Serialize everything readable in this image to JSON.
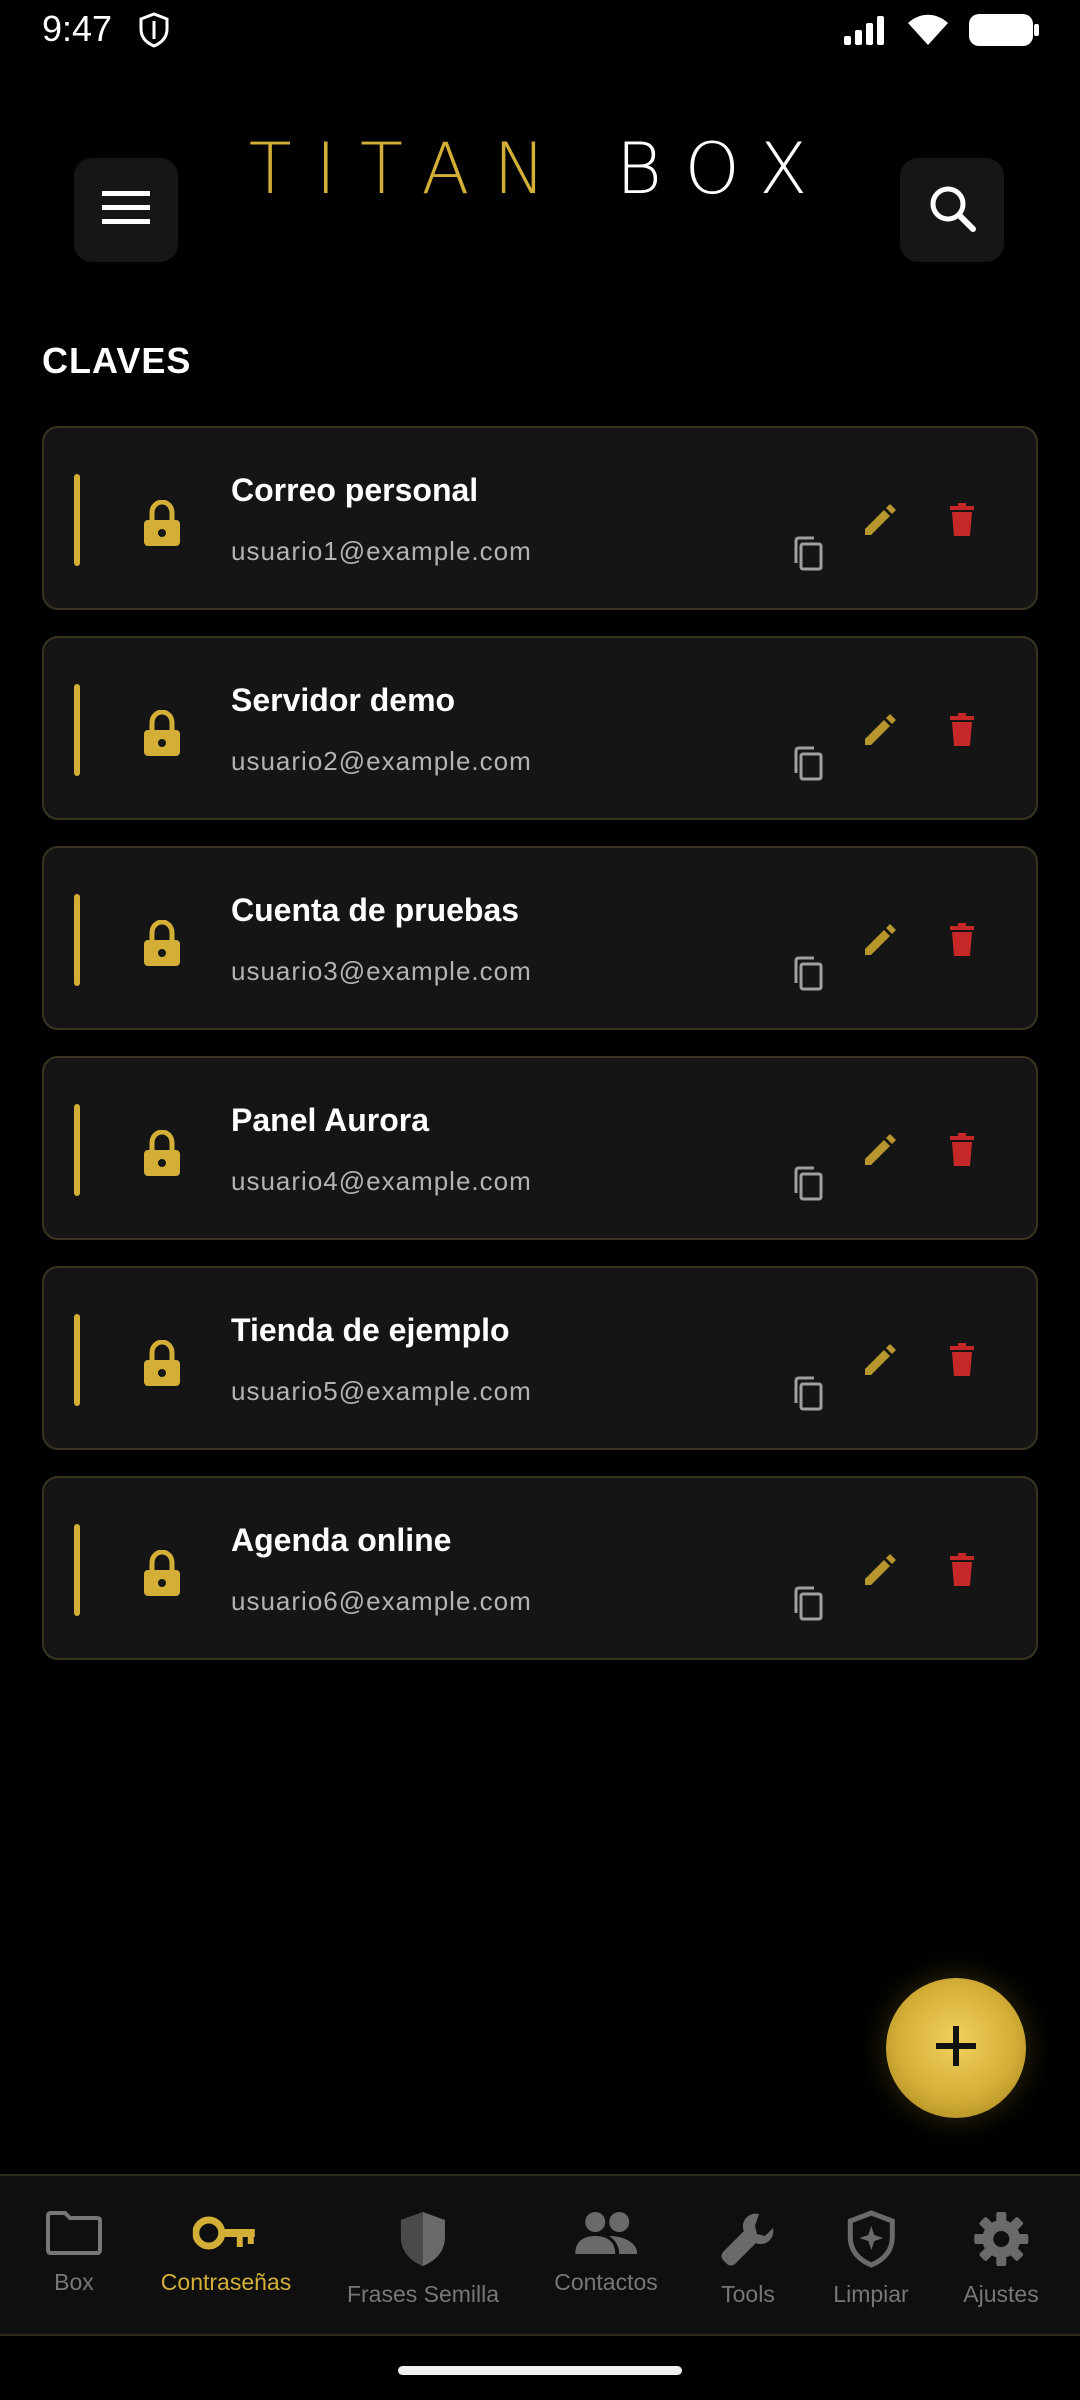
{
  "status": {
    "time": "9:47"
  },
  "header": {
    "logo_part1": "TITAN",
    "logo_part2": "BOX"
  },
  "section_title": "CLAVES",
  "entries": [
    {
      "title": "Correo personal",
      "email": "usuario1@example.com"
    },
    {
      "title": "Servidor demo",
      "email": "usuario2@example.com"
    },
    {
      "title": "Cuenta de pruebas",
      "email": "usuario3@example.com"
    },
    {
      "title": "Panel Aurora",
      "email": "usuario4@example.com"
    },
    {
      "title": "Tienda de ejemplo",
      "email": "usuario5@example.com"
    },
    {
      "title": "Agenda online",
      "email": "usuario6@example.com"
    }
  ],
  "fab_icon": "plus-icon",
  "nav": [
    {
      "label": "Box",
      "icon": "folder-icon",
      "active": false
    },
    {
      "label": "Contraseñas",
      "icon": "key-icon",
      "active": true
    },
    {
      "label": "Frases Semilla",
      "icon": "shield-icon",
      "active": false
    },
    {
      "label": "Contactos",
      "icon": "people-icon",
      "active": false
    },
    {
      "label": "Tools",
      "icon": "wrench-icon",
      "active": false
    },
    {
      "label": "Limpiar",
      "icon": "shield-sparkle-icon",
      "active": false
    },
    {
      "label": "Ajustes",
      "icon": "gear-icon",
      "active": false
    }
  ],
  "colors": {
    "accent": "#d4af37",
    "danger": "#c62828",
    "background": "#000000",
    "card": "#151515"
  }
}
